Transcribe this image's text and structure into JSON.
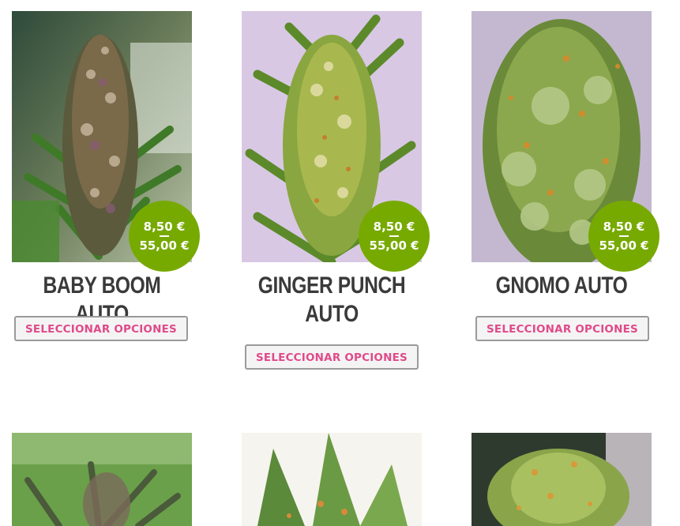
{
  "products": [
    {
      "name": "BABY BOOM AUTO",
      "price_min": "8,50 €",
      "price_max": "55,00 €",
      "button_label": "SELECCIONAR OPCIONES"
    },
    {
      "name": "GINGER PUNCH AUTO",
      "price_min": "8,50 €",
      "price_max": "55,00 €",
      "button_label": "SELECCIONAR OPCIONES"
    },
    {
      "name": "GNOMO AUTO",
      "price_min": "8,50 €",
      "price_max": "55,00 €",
      "button_label": "SELECCIONAR OPCIONES"
    }
  ],
  "colors": {
    "price_badge": "#77aa00",
    "button_text": "#e04a8a",
    "title_text": "#3a3a3a"
  }
}
